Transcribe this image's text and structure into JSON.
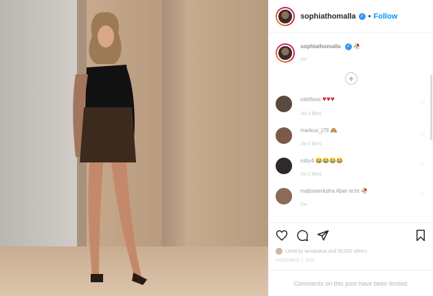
{
  "post": {
    "username": "sophiathomalla",
    "follow_label": "Follow",
    "separator": "•"
  },
  "caption": {
    "username": "sophiathomalla",
    "emoji": "🥀",
    "time": "2w"
  },
  "comments": [
    {
      "user": "nitefloos",
      "text": "♥♥♥",
      "meta": "2w   3 likes"
    },
    {
      "user": "markus_j78",
      "text": "🙈",
      "meta": "2w   2 likes"
    },
    {
      "user": "ruby4",
      "text": "😂😂😂😂",
      "meta": "2w   2 likes"
    },
    {
      "user": "mabswerkstra Aber echt",
      "text": "🥀",
      "meta": "2w"
    }
  ],
  "likes_text": "Liked by iamdaatua and 98,832 others",
  "date": "NOVEMBER 7, 2020",
  "limited_text": "Comments on this post have been limited."
}
